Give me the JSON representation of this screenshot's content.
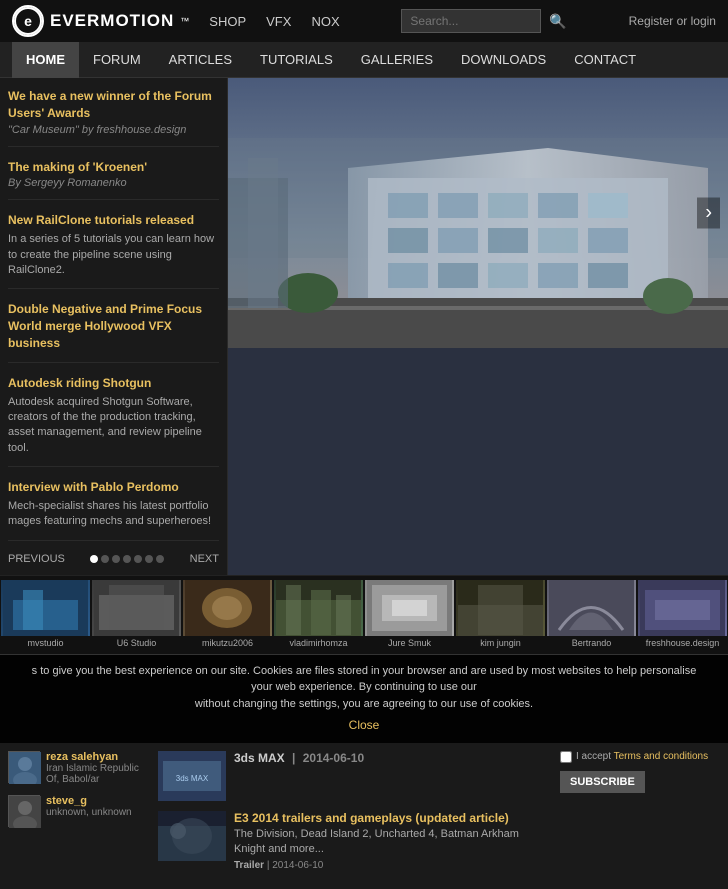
{
  "logo": {
    "circle_text": "E",
    "brand": "EVERMOTION",
    "tm": "™"
  },
  "top_nav": {
    "items": [
      "SHOP",
      "VFX",
      "NOX"
    ]
  },
  "search": {
    "placeholder": "Search..."
  },
  "register": "Register or login",
  "main_nav": {
    "items": [
      "HOME",
      "FORUM",
      "ARTICLES",
      "TUTORIALS",
      "GALLERIES",
      "DOWNLOADS",
      "CONTACT"
    ],
    "active": "HOME"
  },
  "sidebar": {
    "news": [
      {
        "title": "We have a new winner of the Forum Users' Awards",
        "sub": "\"Car Museum\" by freshhouse.design",
        "desc": ""
      },
      {
        "title": "The making of 'Kroenen'",
        "sub": "By Sergeyy Romanenko",
        "desc": ""
      },
      {
        "title": "New RailClone tutorials released",
        "sub": "",
        "desc": "In a series of 5 tutorials you can learn how to create the pipeline scene using RailClone2."
      },
      {
        "title": "Double Negative and Prime Focus World merge Hollywood VFX business",
        "sub": "",
        "desc": ""
      },
      {
        "title": "Autodesk riding Shotgun",
        "sub": "",
        "desc": "Autodesk acquired Shotgun Software, creators of the the production tracking, asset management, and review pipeline tool."
      },
      {
        "title": "Interview with Pablo Perdomo",
        "sub": "",
        "desc": "Mech-specialist shares his latest portfolio mages featuring mechs and superheroes!"
      }
    ],
    "prev": "PREVIOUS",
    "next": "NEXT"
  },
  "thumbnails": [
    {
      "label": "mvstudio",
      "color": "blue"
    },
    {
      "label": "U6 Studio",
      "color": "gray"
    },
    {
      "label": "mikutzu2006",
      "color": "brown"
    },
    {
      "label": "vladimirhomza",
      "color": "green"
    },
    {
      "label": "Jure Smuk",
      "color": "white"
    },
    {
      "label": "kim jungin",
      "color": "dark"
    },
    {
      "label": "Bertrando",
      "color": "arch"
    },
    {
      "label": "freshhouse.design",
      "color": "purple"
    }
  ],
  "cookie": {
    "text": "s to give you the best experience on our site. Cookies are files stored in your browser and are used by most websites to help personalise your web experience. By continuing to use our",
    "text2": "without changing the settings, you are agreeing to our use of cookies.",
    "close": "Close"
  },
  "users": [
    {
      "name": "reza salehyan",
      "location": "Iran Islamic Republic Of, Babol/ar"
    },
    {
      "name": "steve_g",
      "location": "unknown, unknown"
    }
  ],
  "articles": [
    {
      "title": "3ds MAX  |  2014-06-10",
      "desc": "",
      "meta_tag": "",
      "meta": ""
    },
    {
      "title": "E3 2014 trailers and gameplays (updated article)",
      "desc": "The Division, Dead Island 2, Uncharted 4, Batman Arkham Knight and more...",
      "meta_tag": "Trailer",
      "meta": "2014-06-10"
    }
  ],
  "subscribe": {
    "checkbox_label": "I accept Terms and conditions",
    "button": "SUBSCRIBE"
  }
}
